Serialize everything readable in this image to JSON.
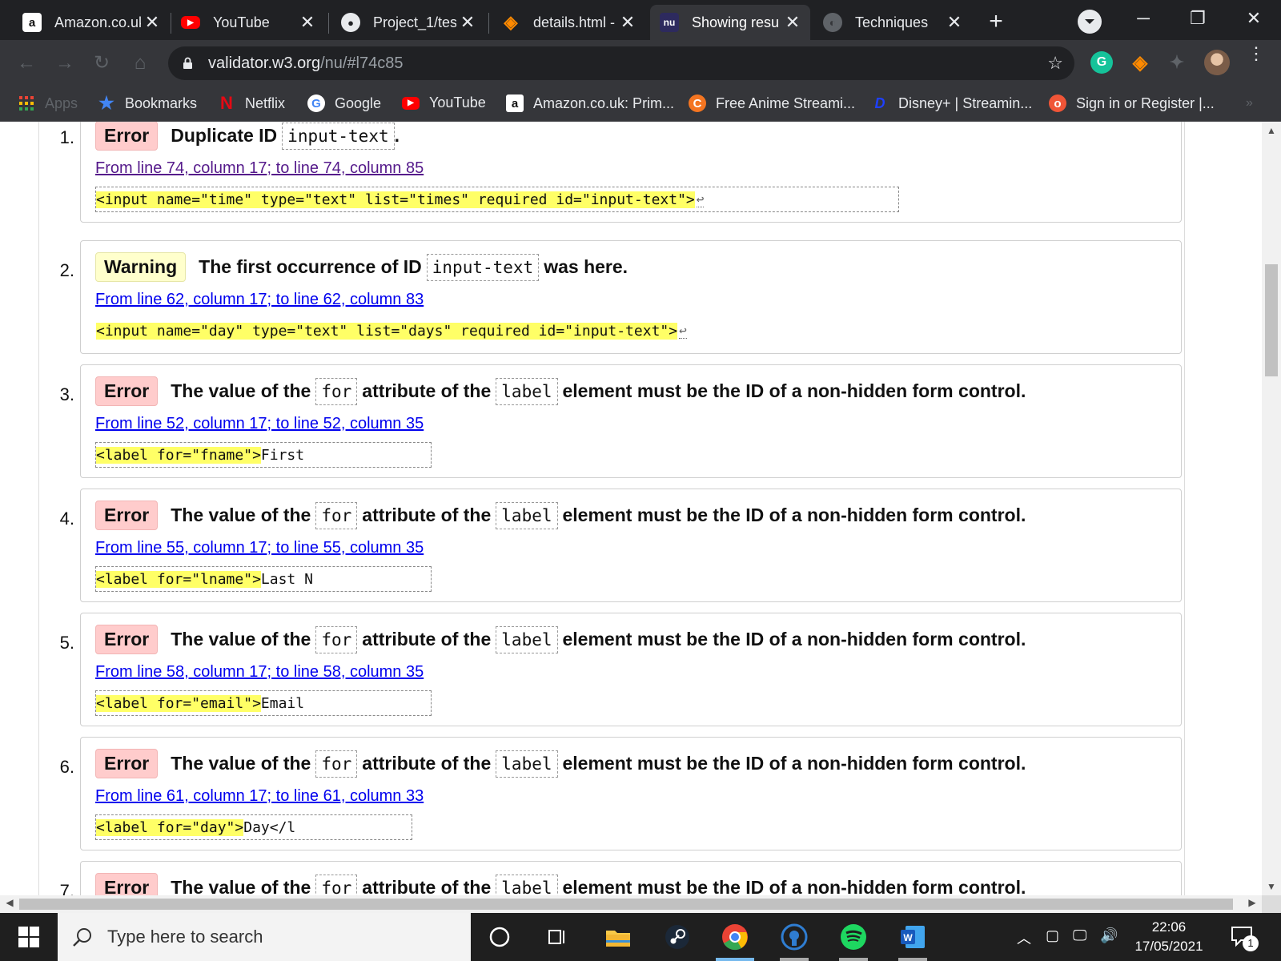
{
  "browser": {
    "tabs": [
      {
        "title": "Amazon.co.uk",
        "icon": "amazon-icon"
      },
      {
        "title": "YouTube",
        "icon": "youtube-icon"
      },
      {
        "title": "Project_1/tes",
        "icon": "github-icon"
      },
      {
        "title": "details.html -",
        "icon": "gitpod-icon"
      },
      {
        "title": "Showing resu",
        "icon": "nu-validator-icon",
        "active": true
      },
      {
        "title": "Techniques",
        "icon": "globe-icon"
      }
    ],
    "url_host": "validator.w3.org",
    "url_path": "/nu/#l74c85",
    "bookmarks": [
      {
        "label": "Apps",
        "icon": "apps-grid-icon"
      },
      {
        "label": "Bookmarks",
        "icon": "star-icon"
      },
      {
        "label": "Netflix",
        "icon": "netflix-icon"
      },
      {
        "label": "Google",
        "icon": "google-icon"
      },
      {
        "label": "YouTube",
        "icon": "youtube-icon"
      },
      {
        "label": "Amazon.co.uk: Prim...",
        "icon": "amazon-icon"
      },
      {
        "label": "Free Anime Streami...",
        "icon": "crunchyroll-icon"
      },
      {
        "label": "Disney+ | Streamin...",
        "icon": "disney-icon"
      },
      {
        "label": "Sign in or Register |...",
        "icon": "eventbrite-icon"
      }
    ]
  },
  "messages": [
    {
      "number": "1.",
      "type": "Error",
      "parts": [
        "Duplicate ID",
        "input-text",
        "."
      ],
      "location": "From line 74, column 17; to line 74, column 85",
      "visited": true,
      "extract_pre": "",
      "extract_hl": "<input name=\"time\" type=\"text\" list=\"times\" required id=\"input-text\">",
      "extract_post": "",
      "return_mark": "↩"
    },
    {
      "number": "2.",
      "type": "Warning",
      "parts": [
        "The first occurrence of ID",
        "input-text",
        "was here."
      ],
      "location": "From line 62, column 17; to line 62, column 83",
      "extract_pre": "",
      "extract_hl": "<input name=\"day\" type=\"text\" list=\"days\" required id=\"input-text\">",
      "extract_post": "",
      "return_mark": "↩"
    },
    {
      "number": "3.",
      "type": "Error",
      "parts": [
        "The value of the",
        "for",
        "attribute of the",
        "label",
        "element must be the ID of a non-hidden form control."
      ],
      "location": "From line 52, column 17; to line 52, column 35",
      "extract_hl": "<label for=\"fname\">",
      "extract_post": "First"
    },
    {
      "number": "4.",
      "type": "Error",
      "parts": [
        "The value of the",
        "for",
        "attribute of the",
        "label",
        "element must be the ID of a non-hidden form control."
      ],
      "location": "From line 55, column 17; to line 55, column 35",
      "extract_hl": "<label for=\"lname\">",
      "extract_post": "Last N"
    },
    {
      "number": "5.",
      "type": "Error",
      "parts": [
        "The value of the",
        "for",
        "attribute of the",
        "label",
        "element must be the ID of a non-hidden form control."
      ],
      "location": "From line 58, column 17; to line 58, column 35",
      "extract_hl": "<label for=\"email\">",
      "extract_post": "Email"
    },
    {
      "number": "6.",
      "type": "Error",
      "parts": [
        "The value of the",
        "for",
        "attribute of the",
        "label",
        "element must be the ID of a non-hidden form control."
      ],
      "location": "From line 61, column 17; to line 61, column 33",
      "extract_hl": "<label for=\"day\">",
      "extract_post": "Day</l"
    },
    {
      "number": "7.",
      "type": "Error",
      "parts": [
        "The value of the",
        "for",
        "attribute of the",
        "label",
        "element must be the ID of a non-hidden form control."
      ]
    }
  ],
  "taskbar": {
    "search_placeholder": "Type here to search",
    "time": "22:06",
    "date": "17/05/2021",
    "notification_count": "1"
  },
  "colors": {
    "error_badge": "#ffcccc",
    "warning_badge": "#ffffcc",
    "highlight": "#ffff66",
    "link": "#0000ee",
    "visited_link": "#551a8b"
  }
}
